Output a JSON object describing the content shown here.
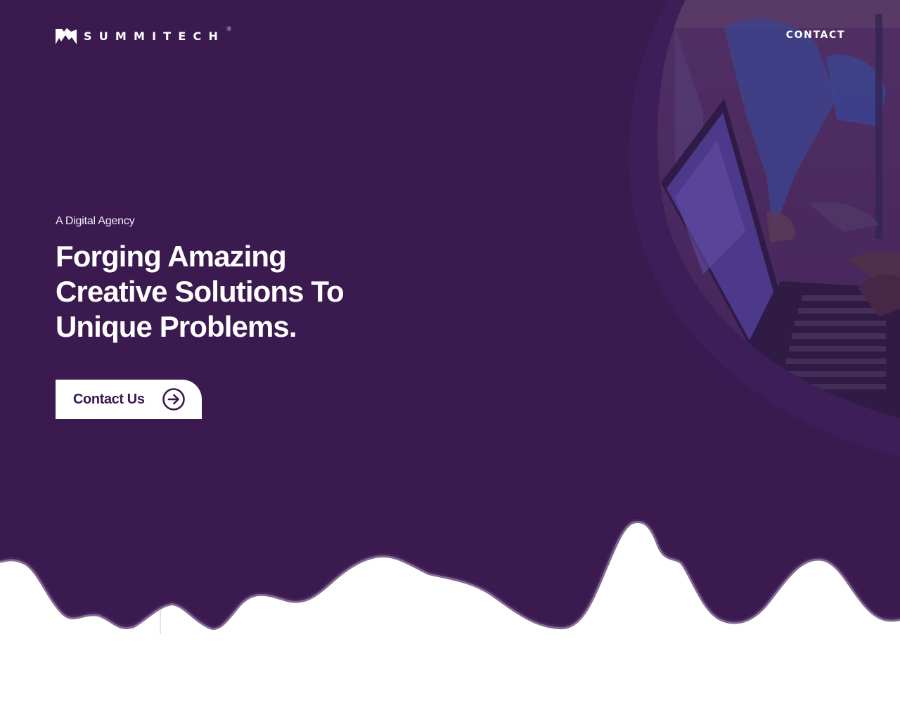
{
  "brand": {
    "name": "SUMMITECH",
    "registered_mark": "®",
    "logo_icon": "mountain-logo-icon"
  },
  "nav": {
    "contact_label": "CONTACT"
  },
  "hero": {
    "eyebrow": "A Digital Agency",
    "headline_lines": [
      "Forging Amazing",
      "Creative Solutions To",
      "Unique Problems."
    ],
    "cta_label": "Contact Us",
    "cta_icon": "arrow-right-circle-icon",
    "photo_description_icon": "laptop-photo"
  },
  "colors": {
    "primary": "#3b1a50",
    "primary_dark": "#331545",
    "white": "#ffffff"
  }
}
